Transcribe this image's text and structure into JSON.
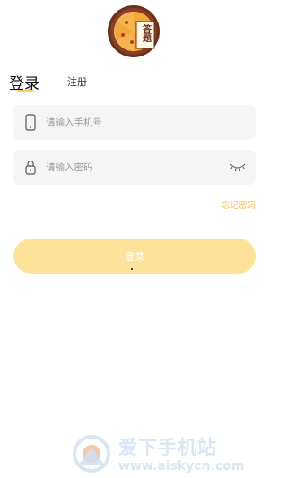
{
  "app": {
    "logo_icon": "pizza-logo-icon",
    "logo_text": "答题"
  },
  "tabs": {
    "login_label": "登录",
    "register_label": "注册",
    "accent_color": "#f7cf5a"
  },
  "form": {
    "phone_placeholder": "请输入手机号",
    "phone_value": "",
    "phone_icon": "phone-icon",
    "password_placeholder": "请输入密码",
    "password_value": "",
    "password_icon": "lock-icon",
    "toggle_visibility_icon": "eye-closed-icon"
  },
  "forgot_password_label": "忘记密码",
  "login_button_label": "登录",
  "login_button_color": "#fde39a",
  "watermark": {
    "title": "爱下手机站",
    "url": "www.aiskycn.com"
  }
}
